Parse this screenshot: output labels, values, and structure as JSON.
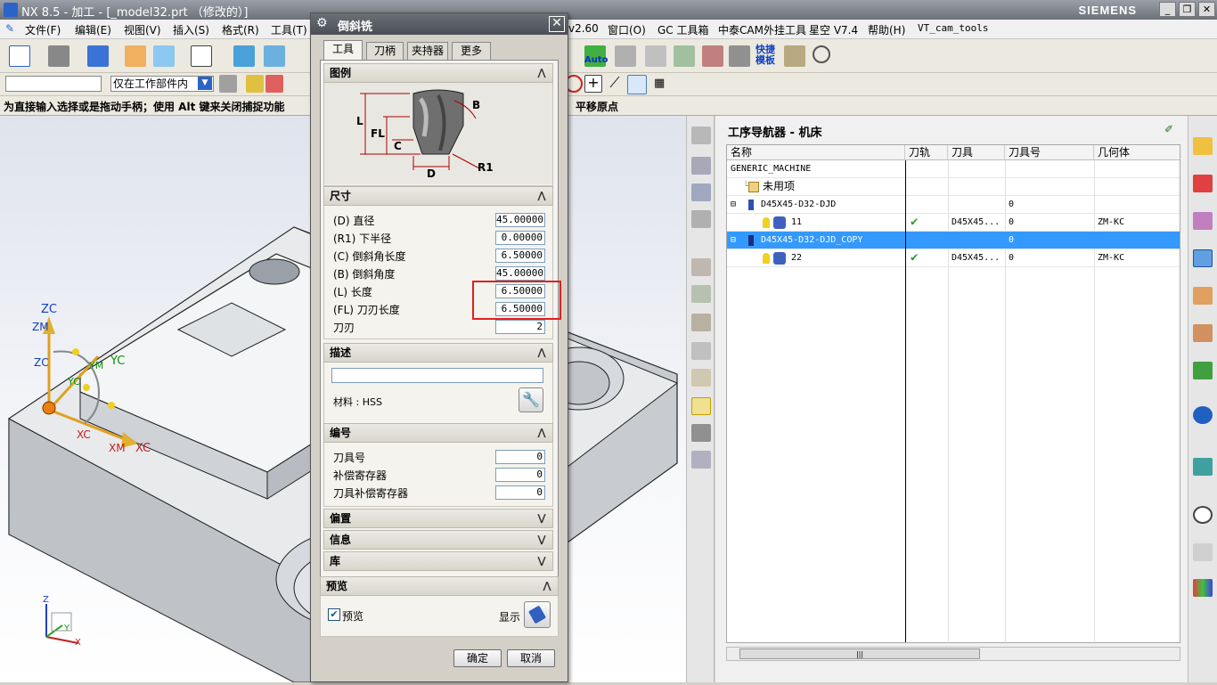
{
  "window": {
    "title": "NX 8.5 - 加工 - [_model32.prt （修改的）]",
    "brand": "SIEMENS",
    "min": "_",
    "restore": "❐",
    "close": "✕"
  },
  "menu": [
    "文件(F)",
    "编辑(E)",
    "视图(V)",
    "插入(S)",
    "格式(R)",
    "工具(T)",
    "v2.60",
    "窗口(O)",
    "GC 工具箱",
    "中泰CAM外挂工具",
    "星空 V7.4",
    "帮助(H)",
    "VT_cam_tools"
  ],
  "toolbar": {
    "filter_value": "仅在工作部件内",
    "auto_label": "Auto",
    "quick_label_1": "快捷",
    "quick_label_2": "模板"
  },
  "cue_line": {
    "left": "为直接输入选择或是拖动手柄；使用 Alt 键来关闭捕捉功能",
    "right": "平移原点"
  },
  "triad": {
    "zc": "ZC",
    "zm": "ZM",
    "zc2": "ZC",
    "ym": "YM",
    "yc": "YC",
    "yc2": "YC",
    "xc": "XC",
    "xm": "XM",
    "xc2": "XC"
  },
  "view_triad": {
    "z": "Z",
    "y": "Y",
    "x": "X"
  },
  "dialog": {
    "title": "倒斜铣",
    "close": "✕",
    "tabs": [
      "工具",
      "刀柄",
      "夹持器",
      "更多"
    ],
    "legend_section": "图例",
    "legend_labels": {
      "l": "L",
      "fl": "FL",
      "c": "C",
      "d": "D",
      "b": "B",
      "r1": "R1"
    },
    "size_section": "尺寸",
    "params": [
      {
        "label": "(D) 直径",
        "value": "45.00000"
      },
      {
        "label": "(R1) 下半径",
        "value": "0.00000"
      },
      {
        "label": "(C) 倒斜角长度",
        "value": "6.50000"
      },
      {
        "label": "(B) 倒斜角度",
        "value": "45.00000"
      },
      {
        "label": "(L) 长度",
        "value": "6.50000"
      },
      {
        "label": "(FL) 刀刃长度",
        "value": "6.50000"
      },
      {
        "label": "刀刃",
        "value": "2"
      }
    ],
    "desc_section": "描述",
    "desc_value": "",
    "material": "材料 : HSS",
    "number_section": "编号",
    "numbers": [
      {
        "label": "刀具号",
        "value": "0"
      },
      {
        "label": "补偿寄存器",
        "value": "0"
      },
      {
        "label": "刀具补偿寄存器",
        "value": "0"
      }
    ],
    "offset_section": "偏置",
    "info_section": "信息",
    "lib_section": "库",
    "preview_section": "预览",
    "preview_check": "预览",
    "show_label": "显示",
    "ok": "确定",
    "cancel": "取消",
    "chev_up": "⋀",
    "chev_down": "⋁"
  },
  "navigator": {
    "title": "工序导航器 - 机床",
    "columns": [
      "名称",
      "刀轨",
      "刀具",
      "刀具号",
      "几何体"
    ],
    "rows": [
      {
        "name": "GENERIC_MACHINE",
        "path": "",
        "tool": "",
        "num": "",
        "geom": ""
      },
      {
        "name": "未用项",
        "path": "",
        "tool": "",
        "num": "",
        "geom": ""
      },
      {
        "name": "D45X45-D32-DJD",
        "path": "",
        "tool": "",
        "num": "0",
        "geom": ""
      },
      {
        "name": "11",
        "path": "✔",
        "tool": "D45X45...",
        "num": "0",
        "geom": "ZM-KC"
      },
      {
        "name": "D45X45-D32-DJD_COPY",
        "path": "",
        "tool": "",
        "num": "0",
        "geom": ""
      },
      {
        "name": "22",
        "path": "✔",
        "tool": "D45X45...",
        "num": "0",
        "geom": "ZM-KC"
      }
    ],
    "scroll_thumb": "|||"
  },
  "colors": {
    "accent": "#3399ff",
    "highlight": "#e02020",
    "check": "#2a9d2a"
  }
}
